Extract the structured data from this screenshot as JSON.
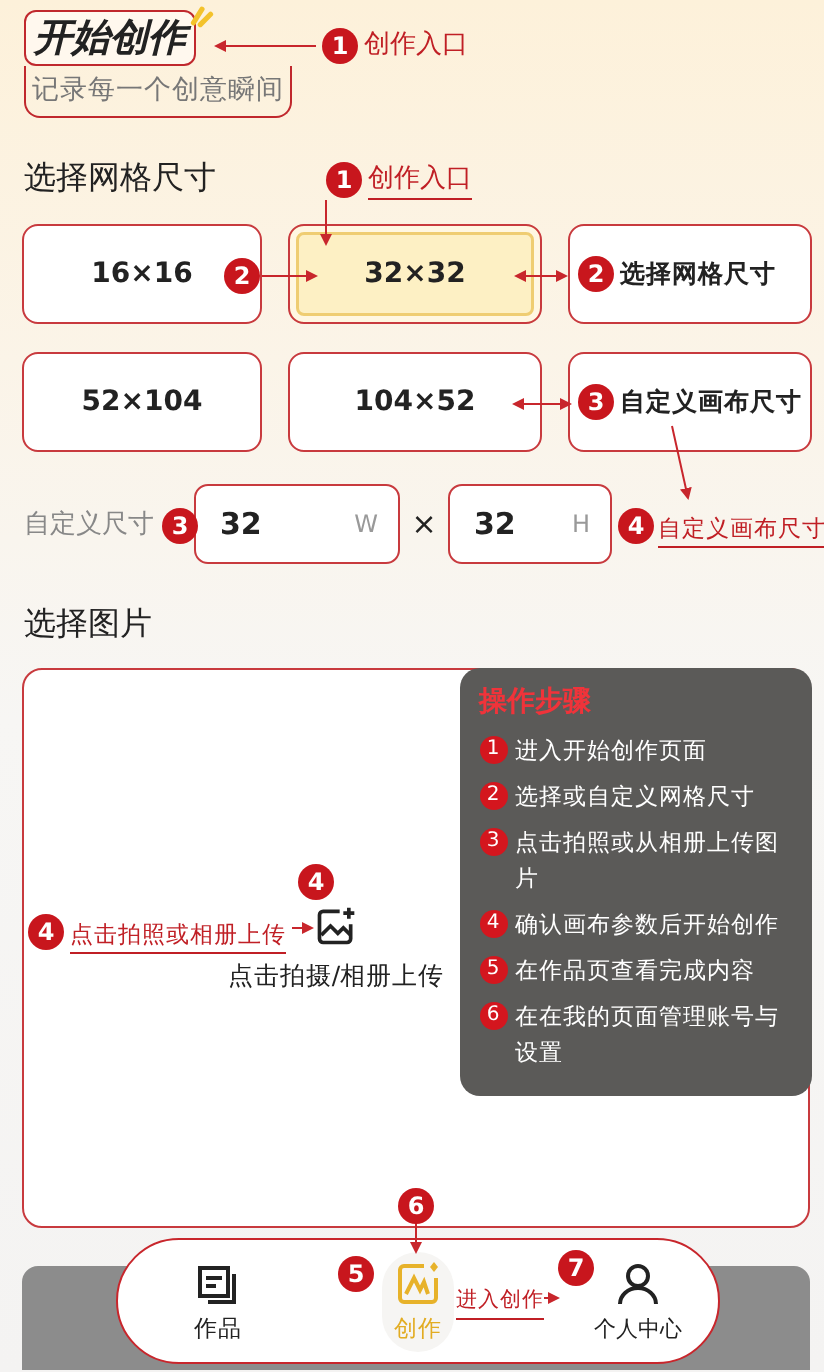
{
  "header": {
    "title": "开始创作",
    "subtitle": "记录每一个创意瞬间"
  },
  "grid_section": {
    "title": "选择网格尺寸",
    "options": [
      {
        "label": "16×16",
        "selected": false
      },
      {
        "label": "32×32",
        "selected": true
      },
      {
        "label": "52×104",
        "selected": false
      },
      {
        "label": "104×52",
        "selected": false
      }
    ]
  },
  "custom_size": {
    "label": "自定义尺寸",
    "width": {
      "value": "32",
      "unit": "W"
    },
    "times": "×",
    "height": {
      "value": "32",
      "unit": "H"
    }
  },
  "image_section": {
    "title": "选择图片",
    "upload_label": "点击拍摄/相册上传"
  },
  "steps_panel": {
    "title": "操作步骤",
    "steps": [
      {
        "number": "1",
        "text": "进入开始创作页面"
      },
      {
        "number": "2",
        "text": "选择或自定义网格尺寸"
      },
      {
        "number": "3",
        "text": "点击拍照或从相册上传图片"
      },
      {
        "number": "4",
        "text": "确认画布参数后开始创作"
      },
      {
        "number": "5",
        "text": "在作品页查看完成内容"
      },
      {
        "number": "6",
        "text": "在在我的页面管理账号与设置"
      }
    ]
  },
  "nav": [
    {
      "label": "作品",
      "kind": "works",
      "selected": false
    },
    {
      "label": "创作",
      "kind": "create",
      "selected": true
    },
    {
      "label": "个人中心",
      "kind": "profile",
      "selected": false
    }
  ],
  "annotations": {
    "title_callout": {
      "number": "1",
      "text": "创作入口"
    },
    "grid_callout": {
      "number": "1",
      "text": "创作入口"
    },
    "option_badge": {
      "number": "2"
    },
    "grid_card_callout": {
      "number": "2",
      "text": "选择网格尺寸"
    },
    "canvas_card_callout": {
      "number": "3",
      "text": "自定义画布尺寸"
    },
    "custom_badge": {
      "number": "3"
    },
    "custom_callout": {
      "number": "4",
      "text": "自定义画布尺寸"
    },
    "upload_callout": {
      "number": "4",
      "text": "点击拍照或相册上传"
    },
    "upload_badge": {
      "number": "4"
    },
    "nav_create_badge": {
      "number": "5"
    },
    "nav_top_badge": {
      "number": "6"
    },
    "nav_profile_badge": {
      "number": "7"
    },
    "nav_callout": {
      "text": "进入创作"
    }
  }
}
